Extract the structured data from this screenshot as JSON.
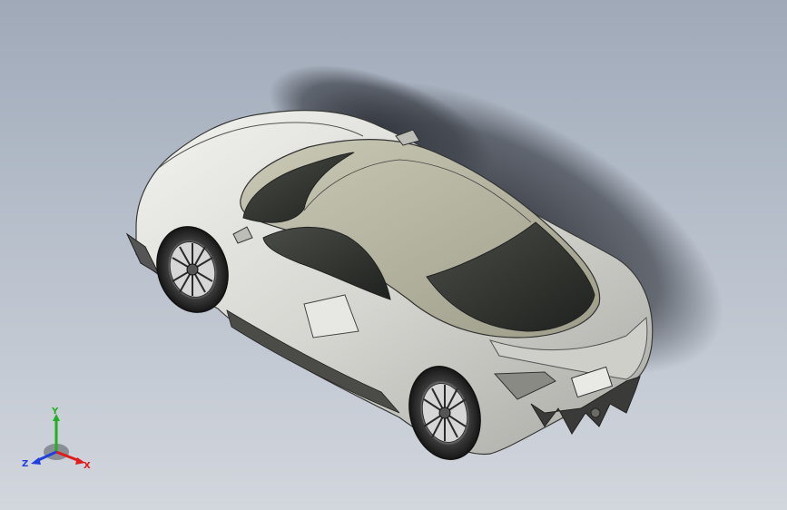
{
  "viewport": {
    "background_top": "#9fa9b8",
    "background_bottom": "#d2d6dd"
  },
  "model": {
    "body_color": "#d9d9d5",
    "glass_color": "#2b2e2a",
    "shadow_color": "#3e424a"
  },
  "triad": {
    "x_label": "X",
    "y_label": "Y",
    "z_label": "Z",
    "x_color": "#e01b1b",
    "y_color": "#22b022",
    "z_color": "#1f3fe0"
  }
}
